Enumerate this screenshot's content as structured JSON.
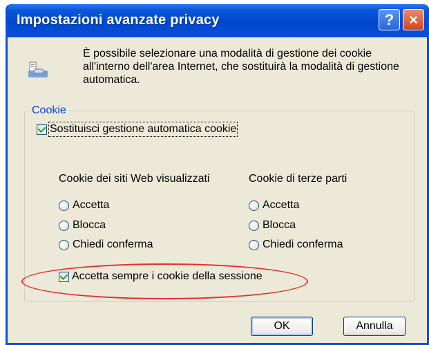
{
  "window": {
    "title": "Impostazioni avanzate privacy",
    "help_glyph": "?",
    "close_glyph": "×"
  },
  "intro": {
    "icon": "privacy-doc-icon",
    "text": "È possibile selezionare una modalità di gestione dei cookie all'interno dell'area Internet, che sostituirà la modalità di gestione automatica."
  },
  "cookie_group": {
    "label": "Cookie",
    "override": {
      "label": "Sostituisci gestione automatica cookie",
      "checked": true
    },
    "first_party": {
      "header": "Cookie dei siti Web visualizzati",
      "options": [
        "Accetta",
        "Blocca",
        "Chiedi conferma"
      ]
    },
    "third_party": {
      "header": "Cookie di terze parti",
      "options": [
        "Accetta",
        "Blocca",
        "Chiedi conferma"
      ]
    },
    "session": {
      "label": "Accetta sempre i cookie della sessione",
      "checked": true
    }
  },
  "buttons": {
    "ok": "OK",
    "cancel": "Annulla"
  },
  "colors": {
    "titlebar": "#0a4fd6",
    "dialog_bg": "#ece9d8",
    "group_label": "#0046d5",
    "highlight_ellipse": "#e03030"
  }
}
